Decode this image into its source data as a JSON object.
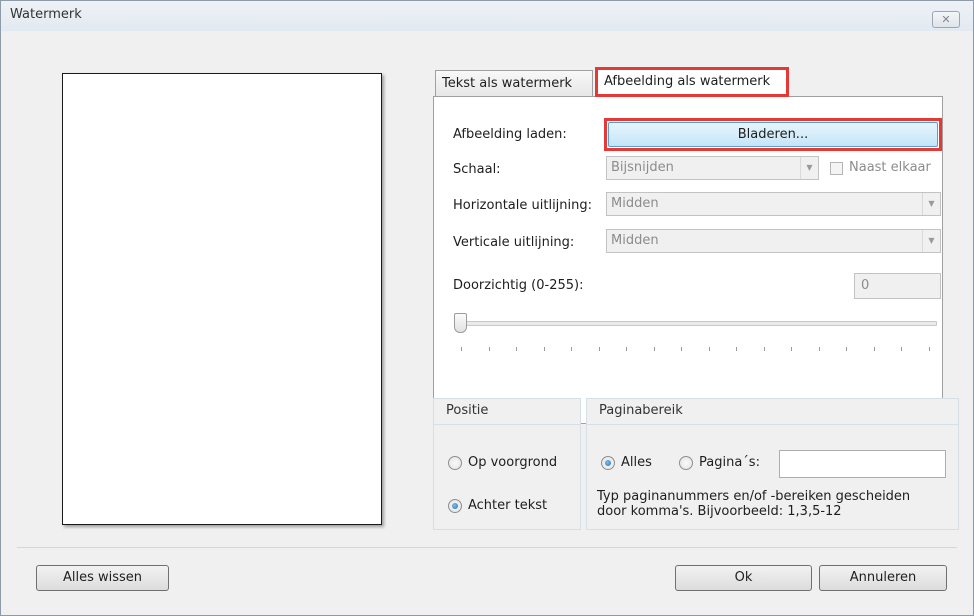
{
  "window": {
    "title": "Watermerk",
    "close_glyph": "✕"
  },
  "tabs": [
    {
      "label": "Tekst als watermerk",
      "active": false
    },
    {
      "label": "Afbeelding als watermerk",
      "active": true
    }
  ],
  "image_tab": {
    "load_label": "Afbeelding laden:",
    "browse_label": "Bladeren...",
    "scale_label": "Schaal:",
    "scale_value": "Bijsnijden",
    "side_by_side_label": "Naast elkaar",
    "side_by_side_checked": false,
    "h_align_label": "Horizontale uitlijning:",
    "h_align_value": "Midden",
    "v_align_label": "Verticale uitlijning:",
    "v_align_value": "Midden",
    "opacity_label": "Doorzichtig (0-255):",
    "opacity_value": "0",
    "slider_value": 0,
    "slider_max": 255,
    "highlight_color": "#e53935"
  },
  "position_group": {
    "title": "Positie",
    "options": [
      {
        "label": "Op voorgrond",
        "checked": false
      },
      {
        "label": "Achter tekst",
        "checked": true
      }
    ]
  },
  "page_range_group": {
    "title": "Paginabereik",
    "all_label": "Alles",
    "all_checked": true,
    "pages_label": "Pagina´s:",
    "pages_checked": false,
    "pages_value": "",
    "hint_line1": "Typ paginanummers en/of -bereiken gescheiden",
    "hint_line2": "door komma's. Bijvoorbeeld: 1,3,5-12"
  },
  "footer": {
    "clear_all": "Alles wissen",
    "ok": "Ok",
    "cancel": "Annuleren"
  }
}
